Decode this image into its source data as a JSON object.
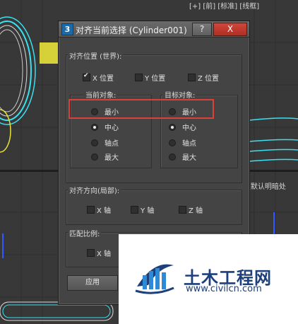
{
  "viewport": {
    "top_label": "[+] [前] [标准] [线框]",
    "right_label": "[默认明暗处"
  },
  "dialog": {
    "icon_text": "3",
    "title": "对齐当前选择 (Cylinder001)",
    "help_label": "?",
    "close_label": "X",
    "align_position_group": "对齐位置 (世界):",
    "x_position": "X 位置",
    "y_position": "Y 位置",
    "z_position": "Z 位置",
    "current_object_group": "当前对象:",
    "target_object_group": "目标对象:",
    "options": [
      "最小",
      "中心",
      "轴点",
      "最大"
    ],
    "current_selected": "中心",
    "target_selected": "中心",
    "align_orientation_group": "对齐方向(局部):",
    "x_axis": "X 轴",
    "y_axis": "Y 轴",
    "z_axis": "Z 轴",
    "match_scale_group": "匹配比例:",
    "scale_x_axis": "X 轴",
    "apply_label": "应用"
  },
  "watermark": {
    "brand_cn": "土木工程网",
    "url": "www.civilcn.com"
  },
  "colors": {
    "dialog_bg": "#444444",
    "highlight_red": "#d9423a",
    "close_red": "#c23a2e",
    "wireframe_cyan": "#39e1f0",
    "wireframe_yellow": "#e8e23a",
    "brand_blue": "#1d3f7a"
  }
}
